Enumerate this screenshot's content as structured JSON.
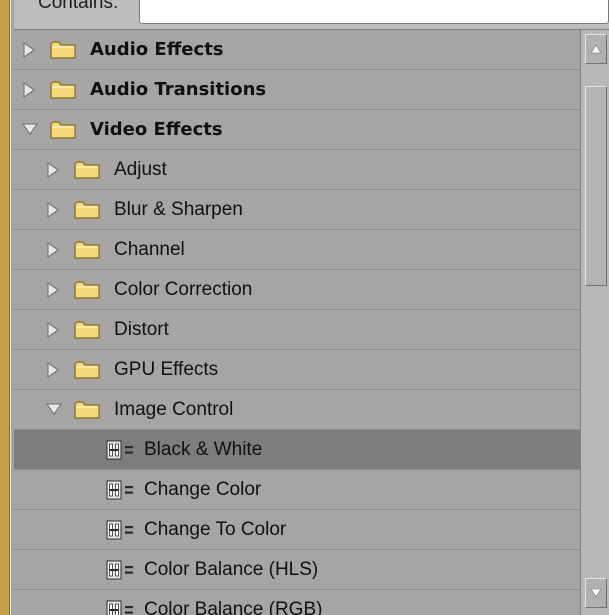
{
  "search": {
    "label": "Contains:",
    "value": ""
  },
  "tree": {
    "items": [
      {
        "label": "Audio Effects",
        "type": "folder",
        "expanded": false,
        "level": 0,
        "bold": true
      },
      {
        "label": "Audio Transitions",
        "type": "folder",
        "expanded": false,
        "level": 0,
        "bold": true
      },
      {
        "label": "Video Effects",
        "type": "folder",
        "expanded": true,
        "level": 0,
        "bold": true
      },
      {
        "label": "Adjust",
        "type": "folder",
        "expanded": false,
        "level": 1
      },
      {
        "label": "Blur & Sharpen",
        "type": "folder",
        "expanded": false,
        "level": 1
      },
      {
        "label": "Channel",
        "type": "folder",
        "expanded": false,
        "level": 1
      },
      {
        "label": "Color Correction",
        "type": "folder",
        "expanded": false,
        "level": 1
      },
      {
        "label": "Distort",
        "type": "folder",
        "expanded": false,
        "level": 1
      },
      {
        "label": "GPU Effects",
        "type": "folder",
        "expanded": false,
        "level": 1
      },
      {
        "label": "Image Control",
        "type": "folder",
        "expanded": true,
        "level": 1
      },
      {
        "label": "Black & White",
        "type": "effect",
        "level": 2,
        "selected": true
      },
      {
        "label": "Change Color",
        "type": "effect",
        "level": 2
      },
      {
        "label": "Change To Color",
        "type": "effect",
        "level": 2
      },
      {
        "label": "Color Balance (HLS)",
        "type": "effect",
        "level": 2
      },
      {
        "label": "Color Balance (RGB)",
        "type": "effect",
        "level": 2
      }
    ]
  },
  "icons": {
    "expand": "triangle-right-icon",
    "collapse": "triangle-down-icon",
    "folder": "folder-icon",
    "effect": "video-effect-icon",
    "scroll_up": "scroll-up-arrow-icon",
    "scroll_down": "scroll-down-arrow-icon"
  },
  "colors": {
    "panel_bg": "#a5a5a5",
    "selected_row": "#7d7d7d",
    "accent_strip": "#c6a04a",
    "folder_yellow": "#f3d77a"
  }
}
